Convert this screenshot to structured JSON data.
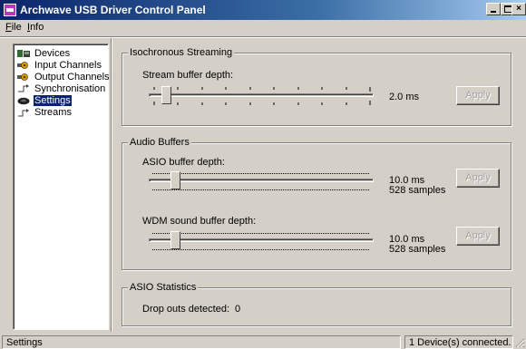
{
  "window": {
    "title": "Archwave USB Driver Control Panel",
    "accent_color": "#0a246a",
    "controls": [
      "minimize-icon",
      "maximize-icon",
      "close-icon"
    ],
    "close_glyph": "×"
  },
  "menu": {
    "items": [
      {
        "mnemonic": "F",
        "rest": "ile"
      },
      {
        "mnemonic": "I",
        "rest": "nfo"
      }
    ]
  },
  "tree": {
    "items": [
      {
        "label": "Devices",
        "icon": "devices-icon"
      },
      {
        "label": "Input Channels",
        "icon": "input-channels-icon"
      },
      {
        "label": "Output Channels",
        "icon": "output-channels-icon"
      },
      {
        "label": "Synchronisation",
        "icon": "sync-icon"
      },
      {
        "label": "Settings",
        "icon": "settings-icon",
        "selected": true
      },
      {
        "label": "Streams",
        "icon": "streams-icon"
      }
    ]
  },
  "iso": {
    "group_title": "Isochronous Streaming",
    "stream_buffer_label": "Stream buffer depth:",
    "stream_buffer_value": "2.0 ms",
    "apply_label": "Apply"
  },
  "audio": {
    "group_title": "Audio Buffers",
    "asio_label": "ASIO buffer depth:",
    "asio_ms": "10.0 ms",
    "asio_samples": "528 samples",
    "wdm_label": "WDM sound buffer depth:",
    "wdm_ms": "10.0 ms",
    "wdm_samples": "528 samples",
    "apply_label": "Apply"
  },
  "stats": {
    "group_title": "ASIO Statistics",
    "dropouts_label": "Drop outs detected:",
    "dropouts_value": "0"
  },
  "status": {
    "left": "Settings",
    "right": "1 Device(s) connected."
  }
}
